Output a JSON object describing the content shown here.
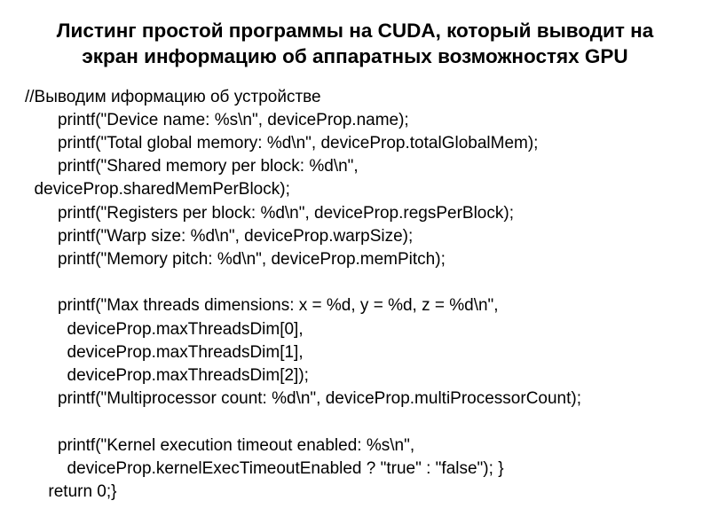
{
  "title_line1": "Листинг простой программы на CUDA, который выводит на",
  "title_line2": "экран информацию об аппаратных возможностях GPU",
  "code_lines": [
    "//Выводим иформацию об устройстве",
    "       printf(\"Device name: %s\\n\", deviceProp.name);",
    "       printf(\"Total global memory: %d\\n\", deviceProp.totalGlobalMem);",
    "       printf(\"Shared memory per block: %d\\n\",",
    "  deviceProp.sharedMemPerBlock);",
    "       printf(\"Registers per block: %d\\n\", deviceProp.regsPerBlock);",
    "       printf(\"Warp size: %d\\n\", deviceProp.warpSize);",
    "       printf(\"Memory pitch: %d\\n\", deviceProp.memPitch);",
    "",
    "       printf(\"Max threads dimensions: x = %d, y = %d, z = %d\\n\",",
    "         deviceProp.maxThreadsDim[0],",
    "         deviceProp.maxThreadsDim[1],",
    "         deviceProp.maxThreadsDim[2]);",
    "       printf(\"Multiprocessor count: %d\\n\", deviceProp.multiProcessorCount);",
    "",
    "       printf(\"Kernel execution timeout enabled: %s\\n\",",
    "         deviceProp.kernelExecTimeoutEnabled ? \"true\" : \"false\"); }",
    "     return 0;}"
  ]
}
